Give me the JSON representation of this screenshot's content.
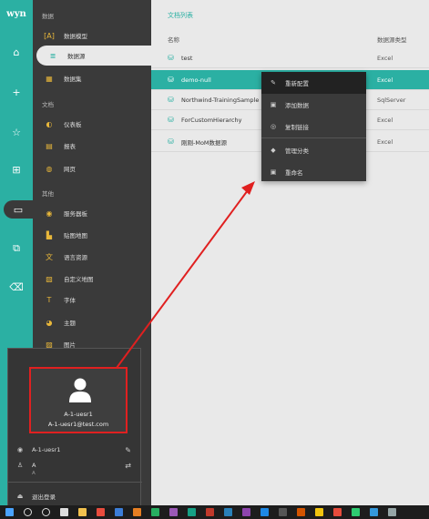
{
  "rail": {
    "logo": "wyn",
    "items": [
      {
        "icon": "home-icon",
        "glyph": "⌂"
      },
      {
        "icon": "plus-icon",
        "glyph": "+"
      },
      {
        "icon": "star-icon",
        "glyph": "☆"
      },
      {
        "icon": "hierarchy-icon",
        "glyph": "⊞"
      },
      {
        "icon": "folder-icon",
        "glyph": "▭"
      },
      {
        "icon": "dashboard-icon",
        "glyph": "⧉"
      },
      {
        "icon": "trash-icon",
        "glyph": "⌫"
      }
    ]
  },
  "sidebar": {
    "sections": [
      {
        "title": "数据",
        "items": [
          {
            "label": "数据模型",
            "icon": "model-icon",
            "glyph": "[A]",
            "color": "#e8b73a"
          },
          {
            "label": "数据源",
            "icon": "datasource-icon",
            "glyph": "≣",
            "color": "#2bb0a3",
            "active": true
          },
          {
            "label": "数据集",
            "icon": "dataset-icon",
            "glyph": "▦",
            "color": "#e8b73a"
          }
        ]
      },
      {
        "title": "文档",
        "items": [
          {
            "label": "仪表板",
            "icon": "dashboard-doc-icon",
            "glyph": "◐",
            "color": "#e8b73a"
          },
          {
            "label": "报表",
            "icon": "report-icon",
            "glyph": "▤",
            "color": "#e8b73a"
          },
          {
            "label": "网页",
            "icon": "webpage-icon",
            "glyph": "◍",
            "color": "#e8b73a"
          }
        ]
      },
      {
        "title": "其他",
        "items": [
          {
            "label": "服务器板",
            "icon": "server-icon",
            "glyph": "◉",
            "color": "#e8b73a"
          },
          {
            "label": "贴图地图",
            "icon": "map-icon",
            "glyph": "▙",
            "color": "#e8b73a"
          },
          {
            "label": "语言资源",
            "icon": "language-icon",
            "glyph": "文",
            "color": "#e8b73a"
          },
          {
            "label": "自定义地图",
            "icon": "custom-map-icon",
            "glyph": "▧",
            "color": "#e8b73a"
          },
          {
            "label": "字体",
            "icon": "font-icon",
            "glyph": "T",
            "color": "#e8b73a"
          },
          {
            "label": "主题",
            "icon": "theme-icon",
            "glyph": "◕",
            "color": "#e8b73a"
          },
          {
            "label": "图片",
            "icon": "image-icon",
            "glyph": "▨",
            "color": "#e8b73a"
          }
        ]
      }
    ]
  },
  "main": {
    "breadcrumb": "文档列表",
    "columns": {
      "name": "名称",
      "type": "数据源类型"
    },
    "rows": [
      {
        "name": "test",
        "type": "Excel",
        "selected": false
      },
      {
        "name": "demo-null",
        "type": "Excel",
        "selected": true
      },
      {
        "name": "Northwind-TrainingSample",
        "type": "SqlServer",
        "selected": false
      },
      {
        "name": "ForCustomHierarchy",
        "type": "Excel",
        "selected": false
      },
      {
        "name": "刚刚-MoM数据源",
        "type": "Excel",
        "selected": false
      }
    ]
  },
  "context_menu": {
    "items": [
      {
        "label": "重新配置",
        "icon": "pencil-icon",
        "glyph": "✎",
        "highlighted": true
      },
      {
        "label": "添加数据",
        "icon": "add-data-icon",
        "glyph": "▣"
      },
      {
        "label": "复制链接",
        "icon": "link-icon",
        "glyph": "◎"
      },
      {
        "label": "管理分类",
        "icon": "tag-icon",
        "glyph": "◆"
      },
      {
        "label": "重命名",
        "icon": "rename-icon",
        "glyph": "▣"
      }
    ]
  },
  "user_popup": {
    "name": "A-1-uesr1",
    "email": "A-1-uesr1@test.com",
    "account_label": "A-1-uesr1",
    "org_label": "A",
    "org_sub": "A",
    "logout_label": "退出登录"
  },
  "colors": {
    "accent": "#2bb0a3",
    "sidebar": "#3a3a3a",
    "highlight_box": "#e02020"
  },
  "taskbar": {
    "items": [
      {
        "icon": "windows-start-icon",
        "color": "#4aa3ff"
      },
      {
        "icon": "search-icon",
        "color": "#dddddd"
      },
      {
        "icon": "cortana-icon",
        "color": "#dddddd"
      },
      {
        "icon": "task-view-icon",
        "color": "#dddddd"
      },
      {
        "icon": "file-explorer-icon",
        "color": "#f2c14e"
      },
      {
        "icon": "chrome-icon",
        "color": "#e84c3d"
      },
      {
        "icon": "app-icon-1",
        "color": "#3b7dd8"
      },
      {
        "icon": "app-icon-2",
        "color": "#e67e22"
      },
      {
        "icon": "app-icon-3",
        "color": "#27ae60"
      },
      {
        "icon": "app-icon-4",
        "color": "#9b59b6"
      },
      {
        "icon": "app-icon-5",
        "color": "#16a085"
      },
      {
        "icon": "app-icon-6",
        "color": "#c0392b"
      },
      {
        "icon": "app-icon-7",
        "color": "#2980b9"
      },
      {
        "icon": "app-icon-8",
        "color": "#8e44ad"
      },
      {
        "icon": "vscode-icon",
        "color": "#1e88e5"
      },
      {
        "icon": "terminal-icon",
        "color": "#555555"
      },
      {
        "icon": "app-icon-9",
        "color": "#d35400"
      },
      {
        "icon": "app-icon-10",
        "color": "#f1c40f"
      },
      {
        "icon": "app-icon-11",
        "color": "#e74c3c"
      },
      {
        "icon": "app-icon-12",
        "color": "#2ecc71"
      },
      {
        "icon": "app-icon-13",
        "color": "#3498db"
      },
      {
        "icon": "app-icon-14",
        "color": "#95a5a6"
      }
    ]
  }
}
